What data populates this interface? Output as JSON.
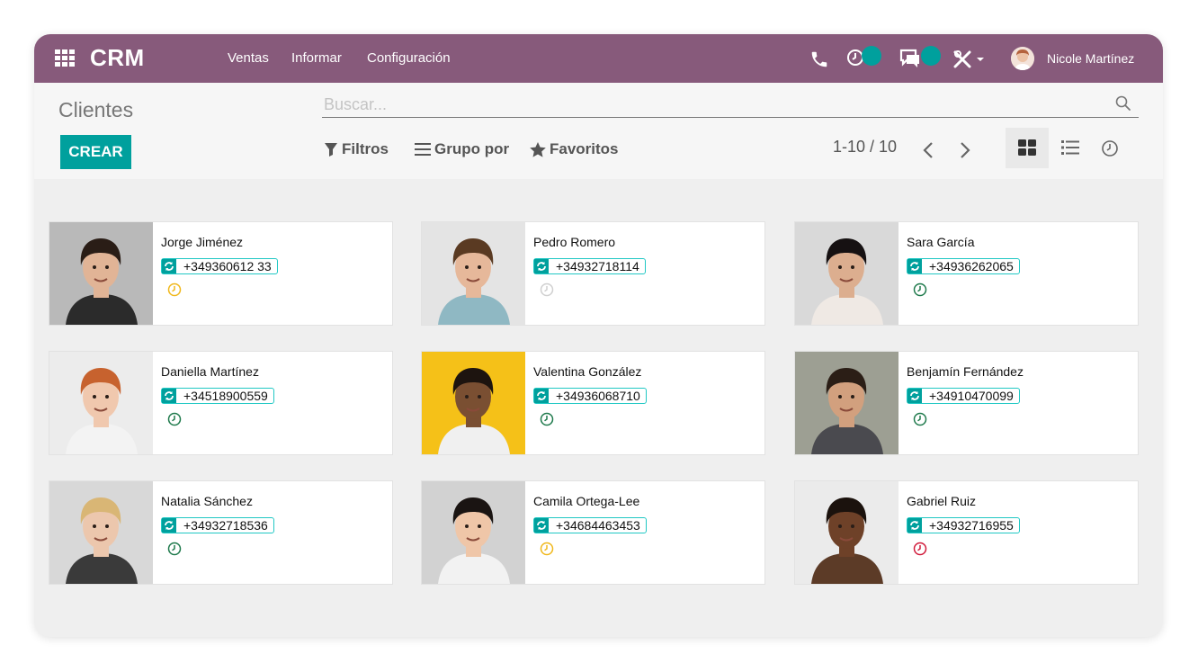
{
  "app": {
    "brand": "CRM"
  },
  "topbar": {
    "menu": [
      "Ventas",
      "Informar",
      "Configuración"
    ],
    "user_name": "Nicole Martínez",
    "accent": "#875a7b",
    "badge_color": "#00a09d"
  },
  "control": {
    "title": "Clientes",
    "create_label": "CREAR",
    "search_placeholder": "Buscar...",
    "filters_label": "Filtros",
    "group_label": "Grupo por",
    "favorites_label": "Favoritos",
    "pager": "1-10 / 10"
  },
  "cards": [
    {
      "name": "Jorge Jiménez",
      "phone": "+349360612 33",
      "activity_color": "#f0b81c",
      "photo_bg": "#b9b9b9",
      "skin": "#e1b496",
      "hair": "#2a1d16",
      "shirt": "#2b2b2b"
    },
    {
      "name": "Pedro Romero",
      "phone": "+34932718114",
      "activity_color": "#d0d0d0",
      "photo_bg": "#e4e4e4",
      "skin": "#e6b89a",
      "hair": "#5a3a22",
      "shirt": "#8fb8c3"
    },
    {
      "name": "Sara García",
      "phone": "+34936262065",
      "activity_color": "#1f7a4c",
      "photo_bg": "#d9d9d9",
      "skin": "#dcae8f",
      "hair": "#161112",
      "shirt": "#efe9e4"
    },
    {
      "name": "Daniella Martínez",
      "phone": "+34518900559",
      "activity_color": "#1f7a4c",
      "photo_bg": "#ececec",
      "skin": "#f0c8ae",
      "hair": "#c7622e",
      "shirt": "#f3f3f3"
    },
    {
      "name": "Valentina González",
      "phone": "+34936068710",
      "activity_color": "#1f7a4c",
      "photo_bg": "#f5c118",
      "skin": "#7a4f32",
      "hair": "#1d140f",
      "shirt": "#f0f0f0"
    },
    {
      "name": "Benjamín Fernández",
      "phone": "+34910470099",
      "activity_color": "#1f7a4c",
      "photo_bg": "#9d9f93",
      "skin": "#d2a07e",
      "hair": "#2b1e16",
      "shirt": "#4a4a4f"
    },
    {
      "name": "Natalia Sánchez",
      "phone": "+34932718536",
      "activity_color": "#1f7a4c",
      "photo_bg": "#d8d8d8",
      "skin": "#ecc7ad",
      "hair": "#d9b675",
      "shirt": "#3a3a3a"
    },
    {
      "name": "Camila Ortega-Lee",
      "phone": "+34684463453",
      "activity_color": "#f0b81c",
      "photo_bg": "#d2d2d2",
      "skin": "#efc6a8",
      "hair": "#1a1412",
      "shirt": "#f2f2f2"
    },
    {
      "name": "Gabriel Ruiz",
      "phone": "+34932716955",
      "activity_color": "#d11a3a",
      "photo_bg": "#ebebeb",
      "skin": "#6e4128",
      "hair": "#1b120d",
      "shirt": "#5c3b27"
    }
  ]
}
